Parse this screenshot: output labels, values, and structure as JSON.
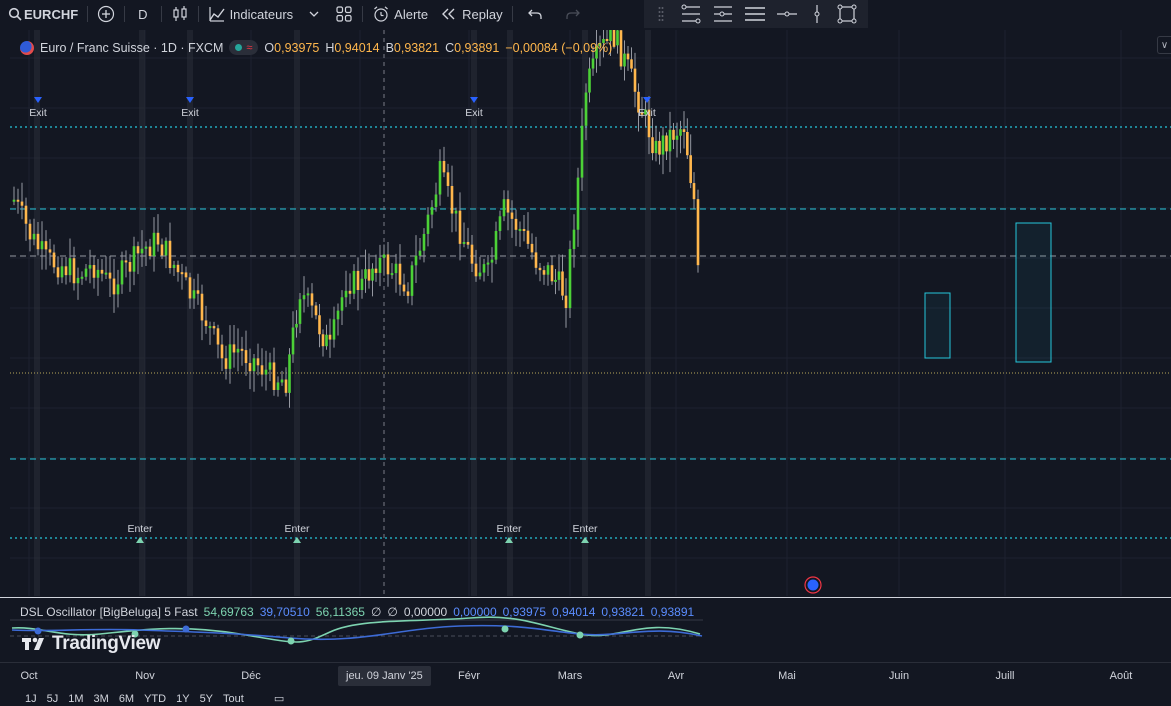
{
  "toolbar": {
    "symbol": "EURCHF",
    "interval": "D",
    "indicators_label": "Indicateurs",
    "alert_label": "Alerte",
    "replay_label": "Replay"
  },
  "legend": {
    "title": "Euro / Franc Suisse · 1D · FXCM",
    "o_key": "O",
    "o_val": "0,93975",
    "h_key": "H",
    "h_val": "0,94014",
    "b_key": "B",
    "b_val": "0,93821",
    "c_key": "C",
    "c_val": "0,93891",
    "change": "−0,00084 (−0,09%)"
  },
  "markers": {
    "exit": "Exit",
    "enter": "Enter"
  },
  "oscillator": {
    "name": "DSL Oscillator [BigBeluga] 5 Fast",
    "v1": "54,69763",
    "v2": "39,70510",
    "v3": "56,11365",
    "sym1": "∅",
    "sym2": "∅",
    "v4": "0,00000",
    "v5": "0,00000",
    "v6": "0,93975",
    "v7": "0,94014",
    "v8": "0,93821",
    "v9": "0,93891"
  },
  "watermark": "TradingView",
  "time_axis": {
    "ticks": [
      "Oct",
      "Nov",
      "Déc",
      "Févr",
      "Mars",
      "Avr",
      "Mai",
      "Juin",
      "Juill",
      "Août"
    ],
    "cursor_label": "jeu. 09 Janv '25"
  },
  "range_buttons": [
    "1J",
    "5J",
    "1M",
    "3M",
    "6M",
    "YTD",
    "1Y",
    "5Y",
    "Tout"
  ],
  "colors": {
    "background": "#131722",
    "bull_candle": "#4cd137",
    "bear_candle": "#ffb74d",
    "level_line": "#26c6da",
    "marker_blue": "#2962ff",
    "marker_green": "#7dd3b0"
  }
}
